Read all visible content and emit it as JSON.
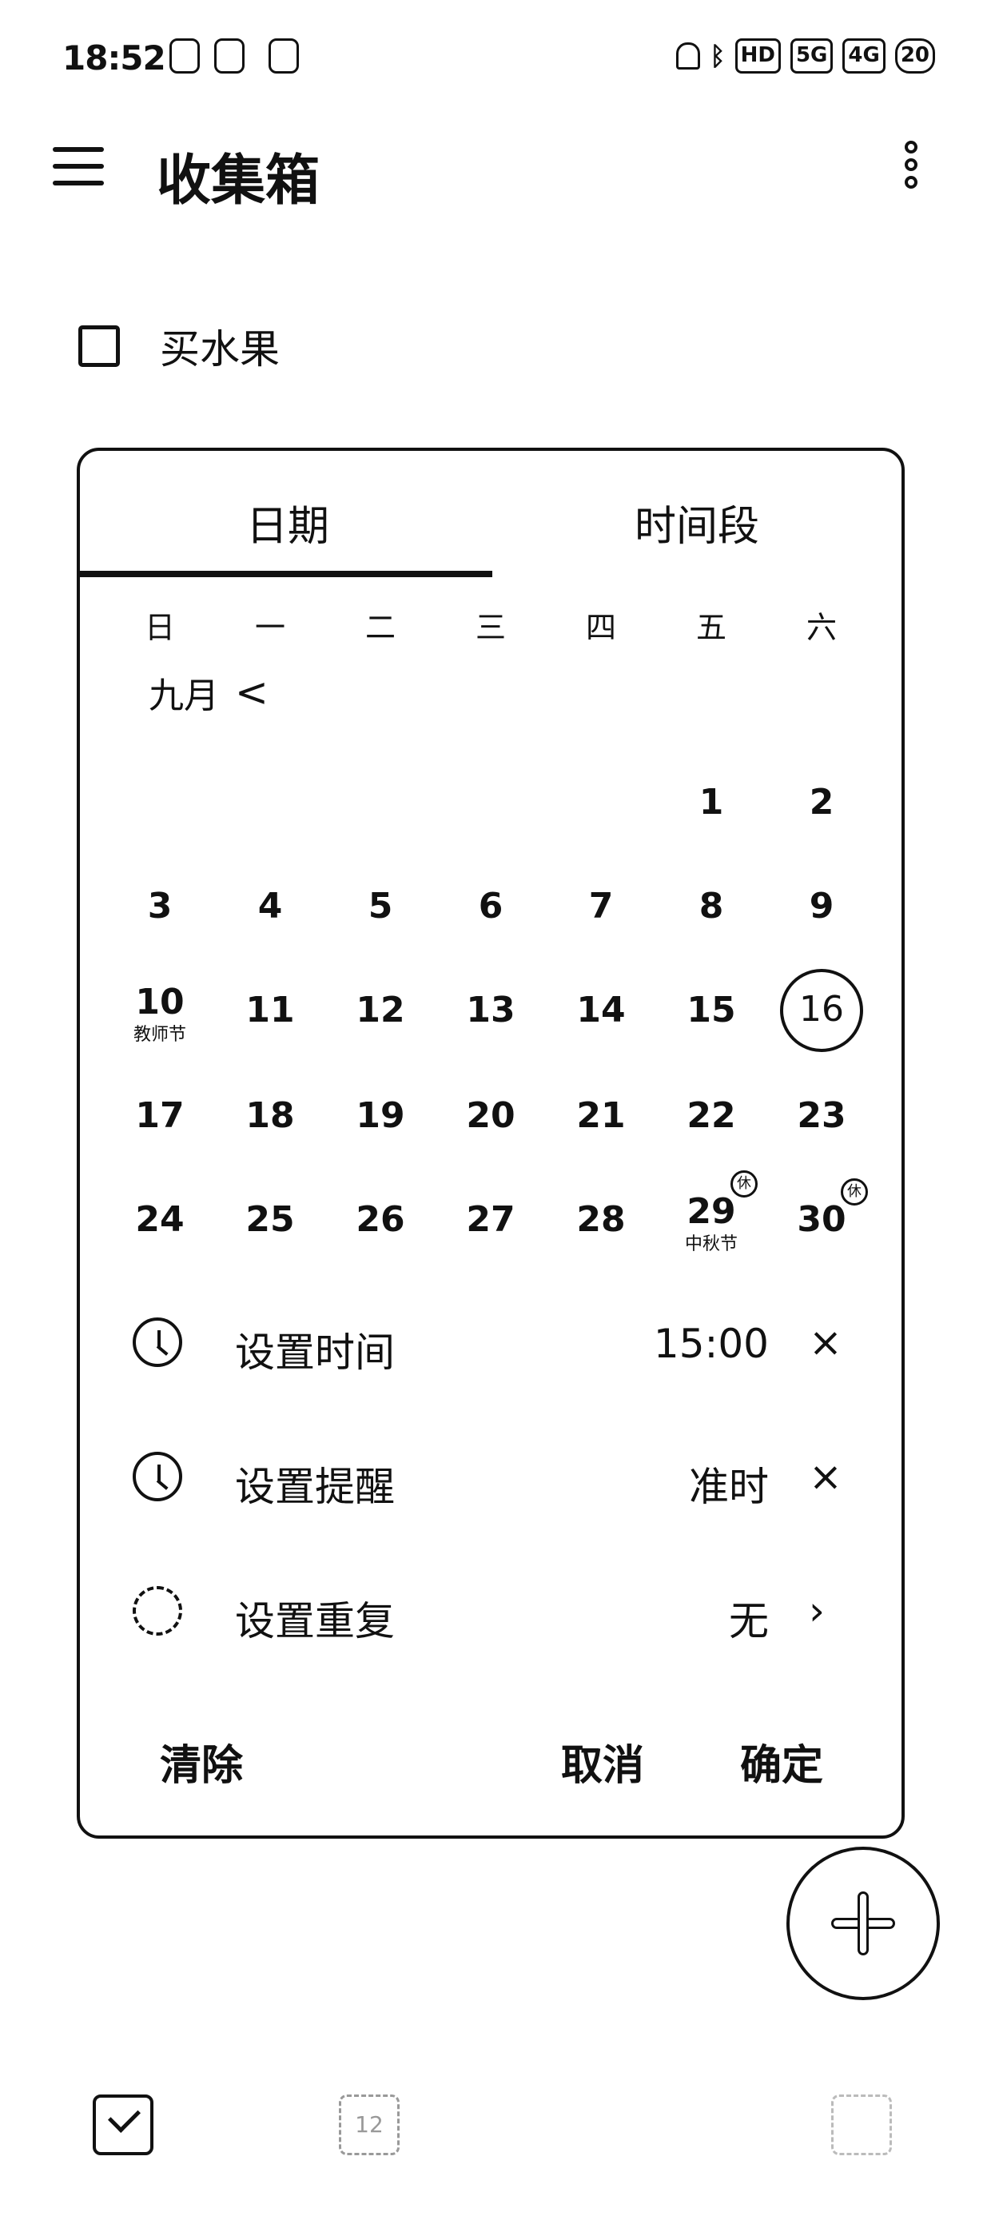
{
  "status_bar": {
    "time": "18:52",
    "left_icons": [
      "shield-app-icon",
      "badge-app-icon",
      "sim-app-icon"
    ],
    "right_icons": [
      "mute-bell-icon",
      "bluetooth-icon",
      "hd-icon",
      "5g-signal-icon",
      "4g-signal-icon",
      "battery-icon"
    ],
    "hd": "HD",
    "net1": "5G",
    "net2": "4G",
    "battery": "20"
  },
  "header": {
    "title": "收集箱"
  },
  "task": {
    "label": "买水果"
  },
  "dialog": {
    "tabs": {
      "date": "日期",
      "range": "时间段"
    },
    "weekdays": [
      "日",
      "一",
      "二",
      "三",
      "四",
      "五",
      "六"
    ],
    "month_label": "九月",
    "prev_chevron": "<",
    "days": {
      "d1": "1",
      "d2": "2",
      "d3": "3",
      "d4": "4",
      "d5": "5",
      "d6": "6",
      "d7": "7",
      "d8": "8",
      "d9": "9",
      "d10": "10",
      "d11": "11",
      "d12": "12",
      "d13": "13",
      "d14": "14",
      "d15": "15",
      "d16": "16",
      "d17": "17",
      "d18": "18",
      "d19": "19",
      "d20": "20",
      "d21": "21",
      "d22": "22",
      "d23": "23",
      "d24": "24",
      "d25": "25",
      "d26": "26",
      "d27": "27",
      "d28": "28",
      "d29": "29",
      "d30": "30"
    },
    "day_subs": {
      "d10": "教师节",
      "d29": "中秋节"
    },
    "holiday_badge": "休",
    "selected_day": "16",
    "settings": {
      "time": {
        "label": "设置时间",
        "value": "15:00",
        "action": "×"
      },
      "reminder": {
        "label": "设置提醒",
        "value": "准时",
        "action": "×"
      },
      "repeat": {
        "label": "设置重复",
        "value": "无",
        "action": "›"
      }
    },
    "buttons": {
      "clear": "清除",
      "cancel": "取消",
      "ok": "确定"
    }
  },
  "fab": {
    "icon": "plus-icon"
  },
  "bottom_nav": {
    "calendar_day": "12"
  }
}
